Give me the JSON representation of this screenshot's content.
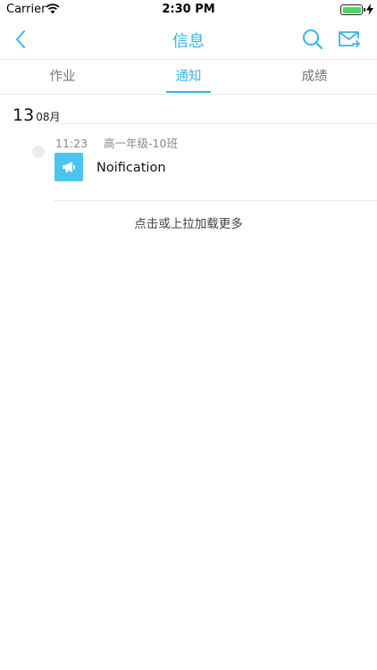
{
  "status_bar": {
    "carrier": "Carrier",
    "time": "2:30 PM",
    "battery_level": 1.0,
    "icons": [
      "wifi-icon",
      "battery-icon",
      "charging-bolt-icon"
    ]
  },
  "nav": {
    "title": "信息",
    "icons": [
      "chevron-left-icon",
      "search-icon",
      "mail-compose-icon"
    ],
    "accent_color": "#36b5e4"
  },
  "tabs": [
    {
      "label": "作业",
      "active": false
    },
    {
      "label": "通知",
      "active": true
    },
    {
      "label": "成绩",
      "active": false
    }
  ],
  "date_group": {
    "day": "13",
    "month": "08月"
  },
  "messages": [
    {
      "time": "11:23",
      "class_name": "高一年级-10班",
      "title": "Noification",
      "icon": "megaphone-icon",
      "icon_color": "#4cc4ee"
    }
  ],
  "load_more_label": "点击或上拉加载更多"
}
